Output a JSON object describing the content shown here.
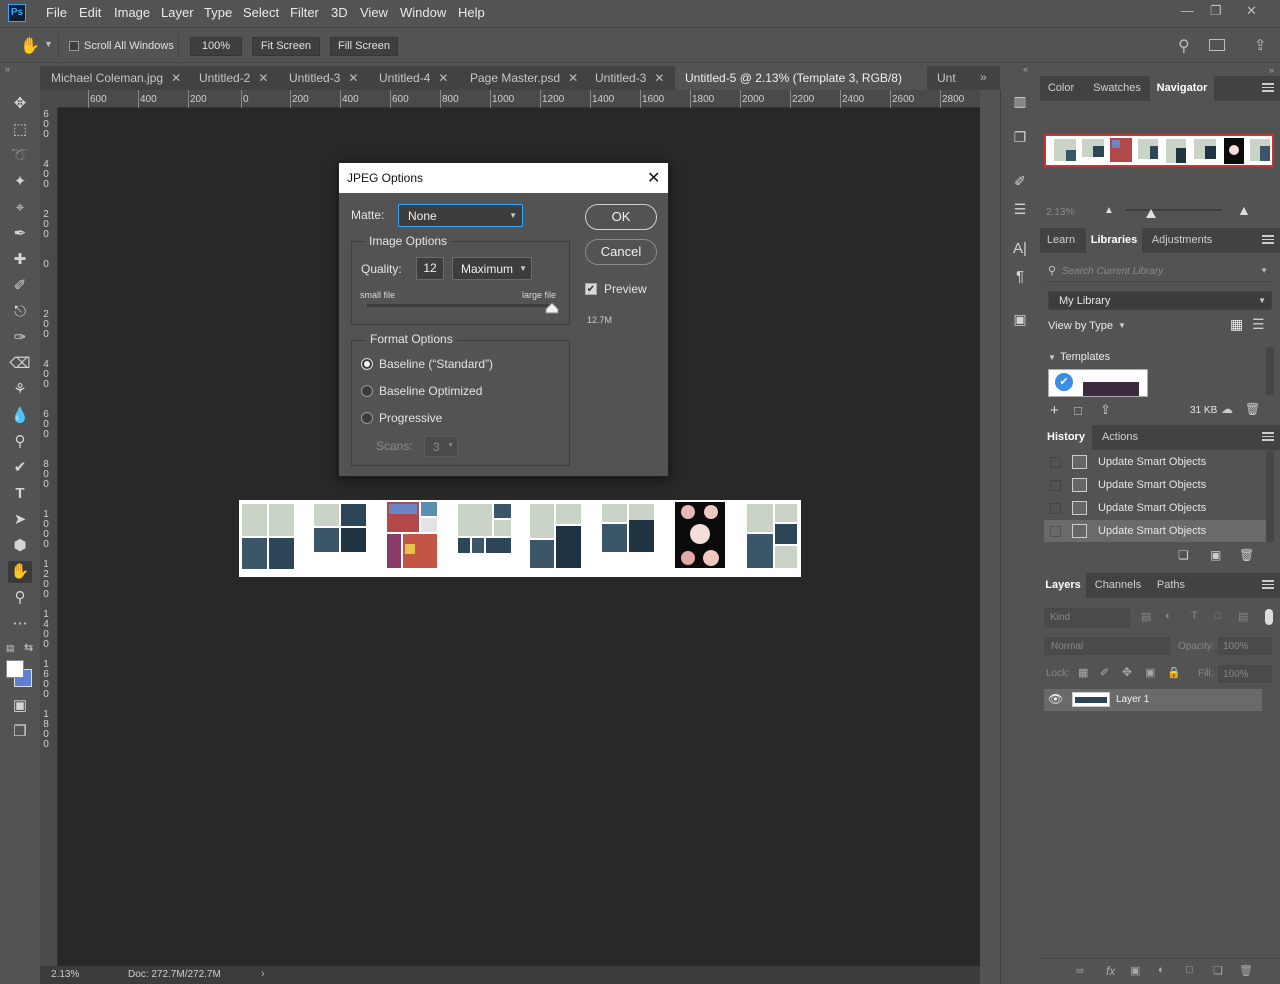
{
  "menubar": {
    "logo": "Ps",
    "items": [
      "File",
      "Edit",
      "Image",
      "Layer",
      "Type",
      "Select",
      "Filter",
      "3D",
      "View",
      "Window",
      "Help"
    ]
  },
  "options": {
    "scroll_all": "Scroll All Windows",
    "zoom": "100%",
    "fit_screen": "Fit Screen",
    "fill_screen": "Fill Screen"
  },
  "tabs": [
    {
      "label": "Michael Coleman.jpg"
    },
    {
      "label": "Untitled-2"
    },
    {
      "label": "Untitled-3"
    },
    {
      "label": "Untitled-4"
    },
    {
      "label": "Page Master.psd"
    },
    {
      "label": "Untitled-3"
    },
    {
      "label": "Untitled-5 @ 2.13% (Template 3, RGB/8) *"
    },
    {
      "label": "Unt"
    }
  ],
  "ruler": {
    "top": [
      "600",
      "400",
      "200",
      "0",
      "200",
      "400",
      "600",
      "800",
      "1000",
      "1200",
      "1400",
      "1600",
      "1800",
      "2000",
      "2200",
      "2400",
      "2600",
      "2800"
    ],
    "left": [
      "600",
      "400",
      "200",
      "0",
      "200",
      "400",
      "600",
      "800",
      "1000",
      "1200",
      "1400",
      "1600",
      "1800"
    ]
  },
  "dialog": {
    "title": "JPEG Options",
    "matte_label": "Matte:",
    "matte_value": "None",
    "image_options": "Image Options",
    "quality_label": "Quality:",
    "quality_value": "12",
    "quality_preset": "Maximum",
    "small_file": "small file",
    "large_file": "large file",
    "quality_slider": 1.0,
    "format_options": "Format Options",
    "baseline_standard": "Baseline (“Standard”)",
    "baseline_optimized": "Baseline Optimized",
    "progressive": "Progressive",
    "scans_label": "Scans:",
    "scans_value": "3",
    "ok": "OK",
    "cancel": "Cancel",
    "preview": "Preview",
    "file_size": "12.7M"
  },
  "status": {
    "zoom": "2.13%",
    "doc": "Doc: 272.7M/272.7M"
  },
  "navigator": {
    "tabs": [
      "Color",
      "Swatches",
      "Navigator"
    ],
    "zoom": "2.13%"
  },
  "libraries": {
    "tabs": [
      "Learn",
      "Libraries",
      "Adjustments"
    ],
    "search_placeholder": "Search Current Library",
    "library": "My Library",
    "view_by": "View by Type",
    "group": "Templates",
    "size": "31 KB"
  },
  "history": {
    "tabs": [
      "History",
      "Actions"
    ],
    "items": [
      "Update Smart Objects",
      "Update Smart Objects",
      "Update Smart Objects",
      "Update Smart Objects"
    ]
  },
  "layers": {
    "tabs": [
      "Layers",
      "Channels",
      "Paths"
    ],
    "kind": "Kind",
    "blend": "Normal",
    "opacity_label": "Opacity:",
    "opacity": "100%",
    "lock_label": "Lock:",
    "fill_label": "Fill:",
    "fill": "100%",
    "layer_name": "Layer 1"
  },
  "colors": {
    "accent": "#31a8ff",
    "canvas": "#282828",
    "panel": "#535353",
    "dark": "#424242"
  }
}
